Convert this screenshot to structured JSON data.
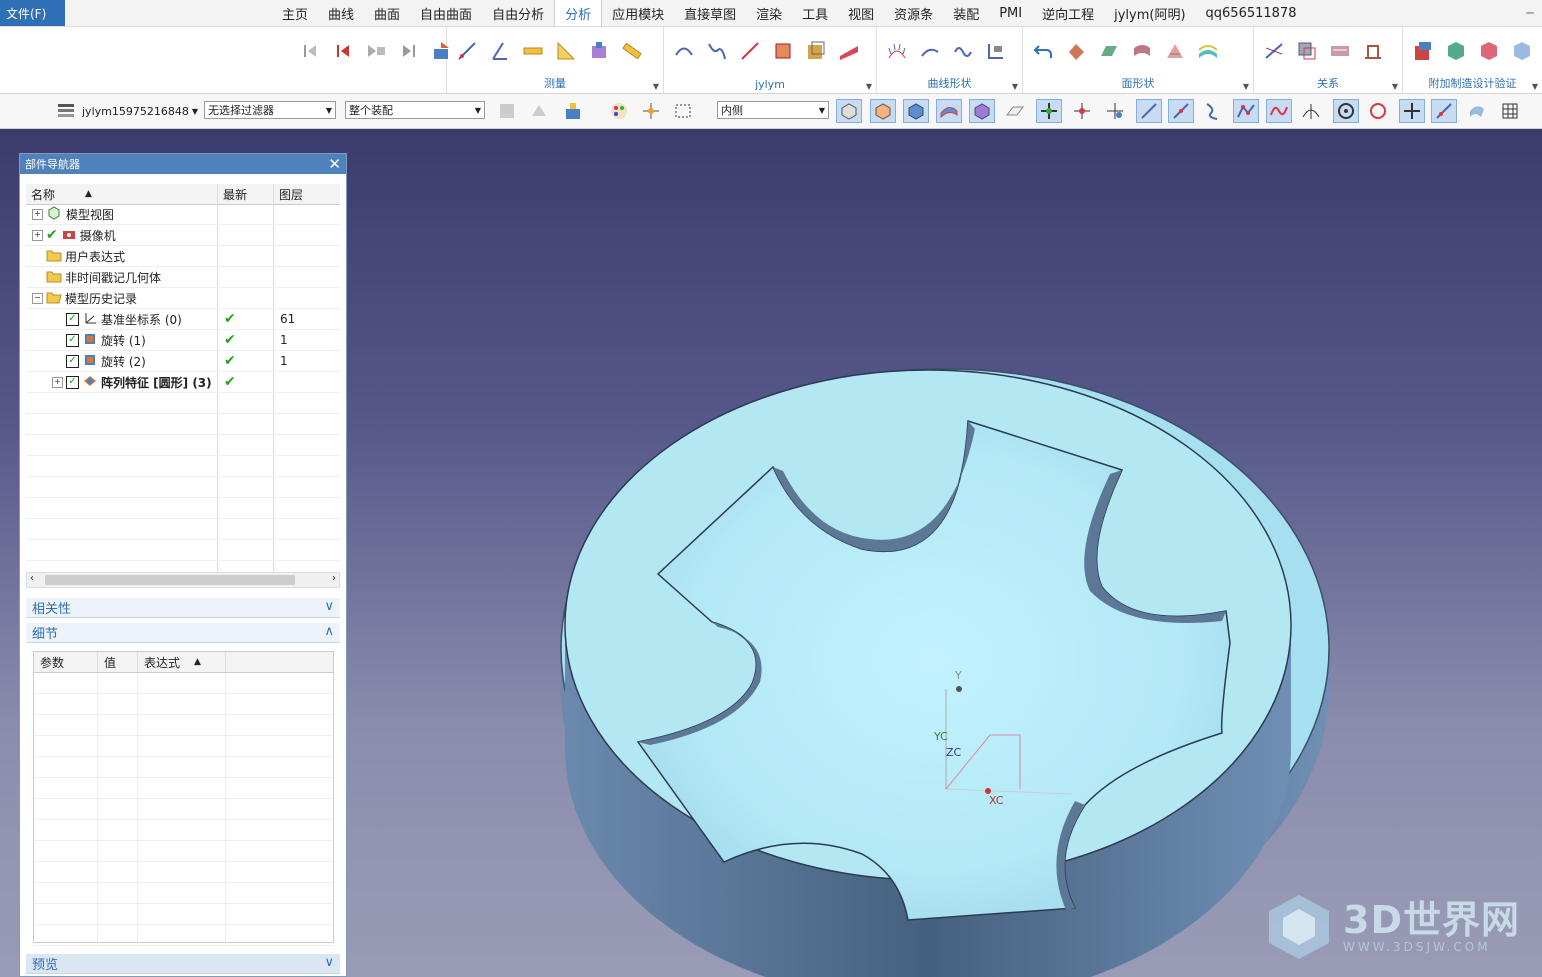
{
  "menu": {
    "file": "文件(F)",
    "tabs": [
      "主页",
      "曲线",
      "曲面",
      "自由曲面",
      "自由分析",
      "分析",
      "应用模块",
      "直接草图",
      "渲染",
      "工具",
      "视图",
      "资源条",
      "装配",
      "PMI",
      "逆向工程",
      "jylym(阿明)",
      "qq656511878"
    ],
    "active_tab_index": 5
  },
  "ribbon": {
    "groups": [
      "测量",
      "jylym",
      "曲线形状",
      "面形状",
      "关系",
      "附加制造设计验证"
    ]
  },
  "toolbar": {
    "user": "jylym15975216848",
    "filter": "无选择过滤器",
    "scope": "整个装配",
    "side": "内侧"
  },
  "navigator": {
    "title": "部件导航器",
    "columns": {
      "name": "名称",
      "latest": "最新",
      "layer": "图层"
    },
    "rows": [
      {
        "label": "模型视图",
        "expander": "+",
        "latest": "",
        "layer": ""
      },
      {
        "label": "摄像机",
        "expander": "+",
        "latest": "",
        "layer": ""
      },
      {
        "label": "用户表达式",
        "expander": "",
        "latest": "",
        "layer": ""
      },
      {
        "label": "非时间戳记几何体",
        "expander": "",
        "latest": "",
        "layer": ""
      },
      {
        "label": "模型历史记录",
        "expander": "−",
        "latest": "",
        "layer": ""
      },
      {
        "label": "基准坐标系 (0)",
        "expander": "",
        "latest": "✔",
        "layer": "61"
      },
      {
        "label": "旋转 (1)",
        "expander": "",
        "latest": "✔",
        "layer": "1"
      },
      {
        "label": "旋转 (2)",
        "expander": "",
        "latest": "✔",
        "layer": "1"
      },
      {
        "label": "阵列特征 [圆形] (3)",
        "expander": "+",
        "latest": "✔",
        "layer": ""
      }
    ],
    "sections": {
      "dependency": "相关性",
      "details": "细节",
      "preview": "预览"
    },
    "detail_columns": {
      "param": "参数",
      "value": "值",
      "expr": "表达式"
    }
  },
  "axes": {
    "y": "Y",
    "yc": "YC",
    "zc": "ZC",
    "xc": "XC"
  },
  "watermark": {
    "big": "3D世界网",
    "small": "WWW.3DSJW.COM"
  }
}
